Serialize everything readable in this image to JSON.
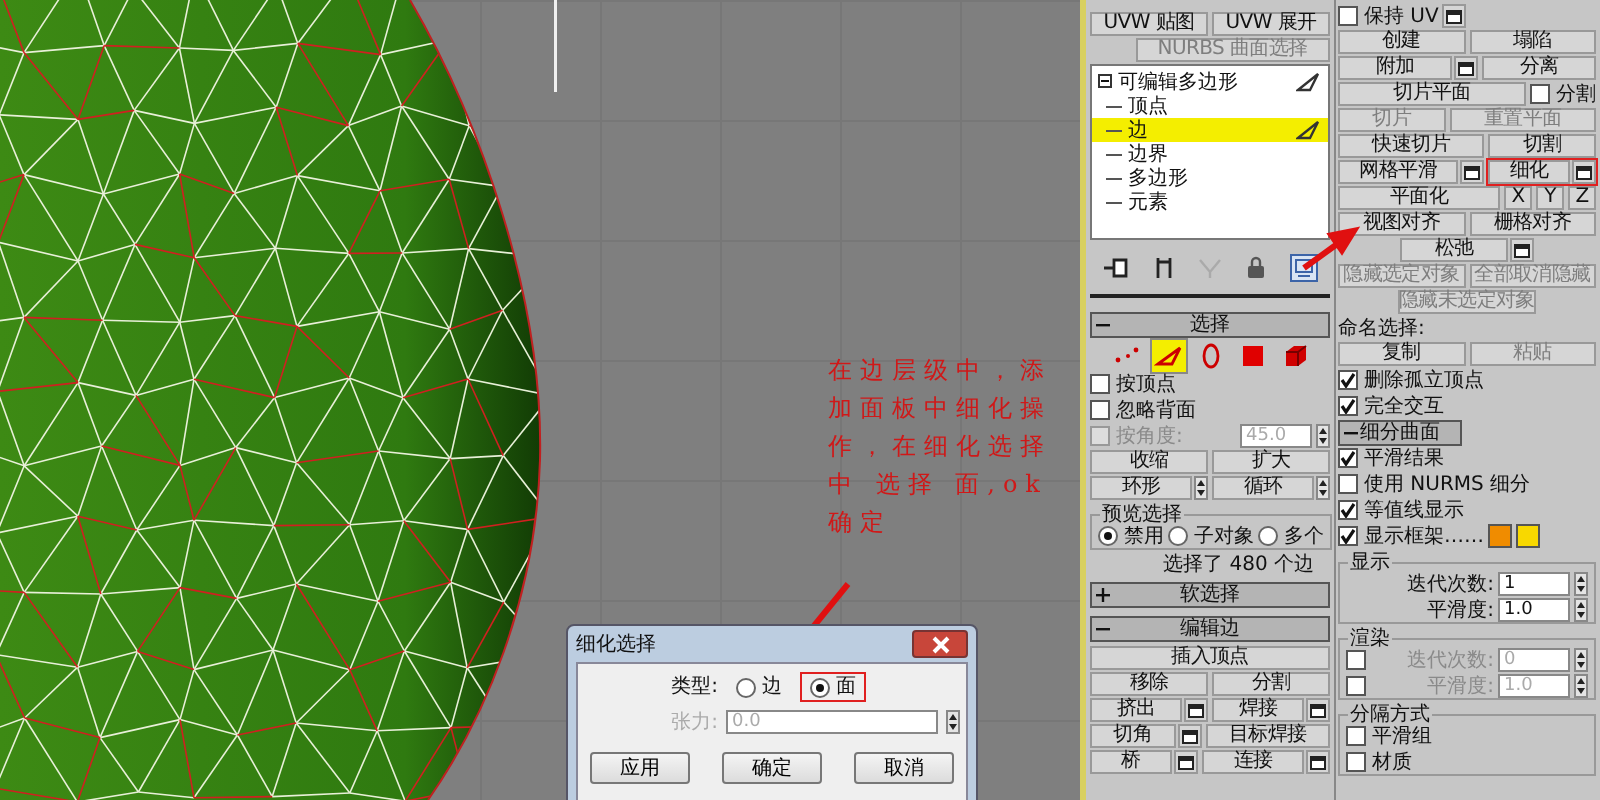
{
  "viewport": {
    "annotation": "在边层级中，添加面板中细化操作，在细化选择中 选择 面,ok确定"
  },
  "dialog": {
    "title": "细化选择",
    "type_label": "类型:",
    "options": [
      {
        "label": "边",
        "selected": false
      },
      {
        "label": "面",
        "selected": true
      }
    ],
    "tension": {
      "label": "张力:",
      "value": "0.0",
      "disabled": true
    },
    "buttons": [
      "应用",
      "确定",
      "取消"
    ]
  },
  "left_panel": {
    "top_rows": [
      [
        {
          "kind": "button",
          "label": "UVW 贴图"
        },
        {
          "kind": "button",
          "label": "UVW 展开"
        }
      ],
      [
        {
          "kind": "spacer"
        },
        {
          "kind": "button",
          "label": "NURBS 曲面选择",
          "disabled": true
        }
      ]
    ],
    "modifier_stack": {
      "label": "可编辑多边形",
      "expanded": true,
      "children": [
        {
          "label": "顶点",
          "selected": false
        },
        {
          "label": "边",
          "selected": true
        },
        {
          "label": "边界",
          "selected": false
        },
        {
          "label": "多边形",
          "selected": false
        },
        {
          "label": "元素",
          "selected": false
        }
      ]
    },
    "rollouts": [
      {
        "title": "选择",
        "expanded": true,
        "subobject_modes": [
          {
            "kind": "vertex",
            "selected": false
          },
          {
            "kind": "edge",
            "selected": true
          },
          {
            "kind": "border",
            "selected": false
          },
          {
            "kind": "polygon",
            "selected": false
          },
          {
            "kind": "element",
            "selected": false
          }
        ],
        "rows": [
          [
            {
              "kind": "checkbox",
              "label": "按顶点",
              "checked": false
            }
          ],
          [
            {
              "kind": "checkbox",
              "label": "忽略背面",
              "checked": false
            }
          ],
          [
            {
              "kind": "checkbox",
              "label": "按角度:",
              "checked": false,
              "disabled": true
            },
            {
              "kind": "spinner",
              "value": "45.0",
              "disabled": true
            }
          ],
          [
            {
              "kind": "button",
              "label": "收缩"
            },
            {
              "kind": "button",
              "label": "扩大"
            }
          ],
          [
            {
              "kind": "button",
              "label": "环形",
              "spin": true
            },
            {
              "kind": "button",
              "label": "循环",
              "spin": true
            }
          ],
          [
            {
              "kind": "group",
              "title": "预览选择",
              "rows": [
                [
                  {
                    "kind": "radio",
                    "label": "禁用",
                    "selected": true
                  },
                  {
                    "kind": "radio",
                    "label": "子对象",
                    "selected": false
                  },
                  {
                    "kind": "radio",
                    "label": "多个",
                    "selected": false
                  }
                ]
              ]
            }
          ],
          [
            {
              "kind": "status",
              "label": "选择了 480 个边"
            }
          ]
        ]
      },
      {
        "title": "软选择",
        "expanded": false
      },
      {
        "title": "编辑边",
        "expanded": true,
        "rows": [
          [
            {
              "kind": "button",
              "label": "插入顶点"
            }
          ],
          [
            {
              "kind": "button",
              "label": "移除"
            },
            {
              "kind": "button",
              "label": "分割"
            }
          ],
          [
            {
              "kind": "button",
              "label": "挤出",
              "settings": true
            },
            {
              "kind": "button",
              "label": "焊接",
              "settings": true
            }
          ],
          [
            {
              "kind": "button",
              "label": "切角",
              "settings": true
            },
            {
              "kind": "button",
              "label": "目标焊接"
            }
          ],
          [
            {
              "kind": "button",
              "label": "桥",
              "settings": true
            },
            {
              "kind": "button",
              "label": "连接",
              "settings": true
            }
          ]
        ]
      }
    ]
  },
  "right_panel": {
    "rows": [
      [
        {
          "kind": "checkbox",
          "label": "保持 UV",
          "checked": false
        },
        {
          "kind": "button",
          "settings": true
        }
      ],
      [
        {
          "kind": "button",
          "label": "创建"
        },
        {
          "kind": "button",
          "label": "塌陷"
        }
      ],
      [
        {
          "kind": "button",
          "label": "附加",
          "settings": true
        },
        {
          "kind": "button",
          "label": "分离"
        }
      ],
      [
        {
          "kind": "button",
          "label": "切片平面"
        },
        {
          "kind": "checkbox",
          "label": "分割",
          "checked": false
        }
      ],
      [
        {
          "kind": "button",
          "label": "切片",
          "disabled": true
        },
        {
          "kind": "button",
          "label": "重置平面",
          "disabled": true
        }
      ],
      [
        {
          "kind": "button",
          "label": "快速切片"
        },
        {
          "kind": "button",
          "label": "切割"
        }
      ],
      [
        {
          "kind": "button",
          "label": "网格平滑",
          "settings": true
        },
        {
          "kind": "button",
          "label": "细化",
          "settings": true,
          "highlighted": true
        }
      ],
      [
        {
          "kind": "button",
          "label": "平面化"
        },
        {
          "kind": "button",
          "label": "X",
          "small": true
        },
        {
          "kind": "button",
          "label": "Y",
          "small": true
        },
        {
          "kind": "button",
          "label": "Z",
          "small": true
        }
      ],
      [
        {
          "kind": "button",
          "label": "视图对齐"
        },
        {
          "kind": "button",
          "label": "栅格对齐"
        }
      ],
      [
        {
          "kind": "button",
          "label": "松弛",
          "settings": true,
          "centered": true
        }
      ],
      [
        {
          "kind": "button",
          "label": "隐藏选定对象",
          "disabled": true
        },
        {
          "kind": "button",
          "label": "全部取消隐藏",
          "disabled": true
        }
      ],
      [
        {
          "kind": "button",
          "label": "隐藏未选定对象",
          "disabled": true,
          "centered": true
        }
      ],
      [
        {
          "kind": "text",
          "label": "命名选择:"
        }
      ],
      [
        {
          "kind": "button",
          "label": "复制"
        },
        {
          "kind": "button",
          "label": "粘贴",
          "disabled": true
        }
      ],
      [
        {
          "kind": "checkbox",
          "label": "删除孤立顶点",
          "checked": true
        }
      ],
      [
        {
          "kind": "checkbox",
          "label": "完全交互",
          "checked": true
        }
      ],
      [
        {
          "kind": "header",
          "label": "细分曲面",
          "expanded": true
        }
      ],
      [
        {
          "kind": "checkbox",
          "label": "平滑结果",
          "checked": true
        }
      ],
      [
        {
          "kind": "checkbox",
          "label": "使用 NURMS 细分",
          "checked": false
        }
      ],
      [
        {
          "kind": "checkbox",
          "label": "等值线显示",
          "checked": true
        }
      ],
      [
        {
          "kind": "checkbox",
          "label": "显示框架……",
          "checked": true
        },
        {
          "kind": "swatch",
          "color": "#f08c00"
        },
        {
          "kind": "swatch",
          "color": "#f8d800"
        }
      ],
      [
        {
          "kind": "group",
          "title": "显示",
          "rows": [
            [
              {
                "kind": "spinner",
                "label": "迭代次数:",
                "value": "1",
                "disabled": false
              }
            ],
            [
              {
                "kind": "spinner",
                "label": "平滑度:",
                "value": "1.0",
                "disabled": false
              }
            ]
          ]
        }
      ],
      [
        {
          "kind": "group",
          "title": "渲染",
          "rows": [
            [
              {
                "kind": "checkbox",
                "checked": false
              },
              {
                "kind": "spinner",
                "label": "迭代次数:",
                "value": "0",
                "disabled": true
              }
            ],
            [
              {
                "kind": "checkbox",
                "checked": false
              },
              {
                "kind": "spinner",
                "label": "平滑度:",
                "value": "1.0",
                "disabled": true
              }
            ]
          ]
        }
      ],
      [
        {
          "kind": "group",
          "title": "分隔方式",
          "rows": [
            [
              {
                "kind": "checkbox",
                "label": "平滑组",
                "checked": false
              }
            ],
            [
              {
                "kind": "checkbox",
                "label": "材质",
                "checked": false
              }
            ]
          ]
        }
      ]
    ]
  }
}
